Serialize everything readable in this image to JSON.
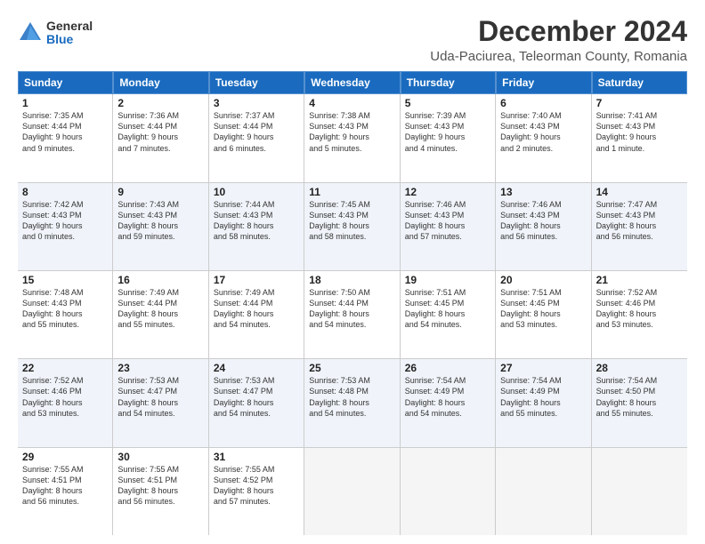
{
  "logo": {
    "general": "General",
    "blue": "Blue"
  },
  "title": "December 2024",
  "subtitle": "Uda-Paciurea, Teleorman County, Romania",
  "days": [
    "Sunday",
    "Monday",
    "Tuesday",
    "Wednesday",
    "Thursday",
    "Friday",
    "Saturday"
  ],
  "weeks": [
    [
      {
        "day": "1",
        "info": "Sunrise: 7:35 AM\nSunset: 4:44 PM\nDaylight: 9 hours\nand 9 minutes."
      },
      {
        "day": "2",
        "info": "Sunrise: 7:36 AM\nSunset: 4:44 PM\nDaylight: 9 hours\nand 7 minutes."
      },
      {
        "day": "3",
        "info": "Sunrise: 7:37 AM\nSunset: 4:44 PM\nDaylight: 9 hours\nand 6 minutes."
      },
      {
        "day": "4",
        "info": "Sunrise: 7:38 AM\nSunset: 4:43 PM\nDaylight: 9 hours\nand 5 minutes."
      },
      {
        "day": "5",
        "info": "Sunrise: 7:39 AM\nSunset: 4:43 PM\nDaylight: 9 hours\nand 4 minutes."
      },
      {
        "day": "6",
        "info": "Sunrise: 7:40 AM\nSunset: 4:43 PM\nDaylight: 9 hours\nand 2 minutes."
      },
      {
        "day": "7",
        "info": "Sunrise: 7:41 AM\nSunset: 4:43 PM\nDaylight: 9 hours\nand 1 minute."
      }
    ],
    [
      {
        "day": "8",
        "info": "Sunrise: 7:42 AM\nSunset: 4:43 PM\nDaylight: 9 hours\nand 0 minutes."
      },
      {
        "day": "9",
        "info": "Sunrise: 7:43 AM\nSunset: 4:43 PM\nDaylight: 8 hours\nand 59 minutes."
      },
      {
        "day": "10",
        "info": "Sunrise: 7:44 AM\nSunset: 4:43 PM\nDaylight: 8 hours\nand 58 minutes."
      },
      {
        "day": "11",
        "info": "Sunrise: 7:45 AM\nSunset: 4:43 PM\nDaylight: 8 hours\nand 58 minutes."
      },
      {
        "day": "12",
        "info": "Sunrise: 7:46 AM\nSunset: 4:43 PM\nDaylight: 8 hours\nand 57 minutes."
      },
      {
        "day": "13",
        "info": "Sunrise: 7:46 AM\nSunset: 4:43 PM\nDaylight: 8 hours\nand 56 minutes."
      },
      {
        "day": "14",
        "info": "Sunrise: 7:47 AM\nSunset: 4:43 PM\nDaylight: 8 hours\nand 56 minutes."
      }
    ],
    [
      {
        "day": "15",
        "info": "Sunrise: 7:48 AM\nSunset: 4:43 PM\nDaylight: 8 hours\nand 55 minutes."
      },
      {
        "day": "16",
        "info": "Sunrise: 7:49 AM\nSunset: 4:44 PM\nDaylight: 8 hours\nand 55 minutes."
      },
      {
        "day": "17",
        "info": "Sunrise: 7:49 AM\nSunset: 4:44 PM\nDaylight: 8 hours\nand 54 minutes."
      },
      {
        "day": "18",
        "info": "Sunrise: 7:50 AM\nSunset: 4:44 PM\nDaylight: 8 hours\nand 54 minutes."
      },
      {
        "day": "19",
        "info": "Sunrise: 7:51 AM\nSunset: 4:45 PM\nDaylight: 8 hours\nand 54 minutes."
      },
      {
        "day": "20",
        "info": "Sunrise: 7:51 AM\nSunset: 4:45 PM\nDaylight: 8 hours\nand 53 minutes."
      },
      {
        "day": "21",
        "info": "Sunrise: 7:52 AM\nSunset: 4:46 PM\nDaylight: 8 hours\nand 53 minutes."
      }
    ],
    [
      {
        "day": "22",
        "info": "Sunrise: 7:52 AM\nSunset: 4:46 PM\nDaylight: 8 hours\nand 53 minutes."
      },
      {
        "day": "23",
        "info": "Sunrise: 7:53 AM\nSunset: 4:47 PM\nDaylight: 8 hours\nand 54 minutes."
      },
      {
        "day": "24",
        "info": "Sunrise: 7:53 AM\nSunset: 4:47 PM\nDaylight: 8 hours\nand 54 minutes."
      },
      {
        "day": "25",
        "info": "Sunrise: 7:53 AM\nSunset: 4:48 PM\nDaylight: 8 hours\nand 54 minutes."
      },
      {
        "day": "26",
        "info": "Sunrise: 7:54 AM\nSunset: 4:49 PM\nDaylight: 8 hours\nand 54 minutes."
      },
      {
        "day": "27",
        "info": "Sunrise: 7:54 AM\nSunset: 4:49 PM\nDaylight: 8 hours\nand 55 minutes."
      },
      {
        "day": "28",
        "info": "Sunrise: 7:54 AM\nSunset: 4:50 PM\nDaylight: 8 hours\nand 55 minutes."
      }
    ],
    [
      {
        "day": "29",
        "info": "Sunrise: 7:55 AM\nSunset: 4:51 PM\nDaylight: 8 hours\nand 56 minutes."
      },
      {
        "day": "30",
        "info": "Sunrise: 7:55 AM\nSunset: 4:51 PM\nDaylight: 8 hours\nand 56 minutes."
      },
      {
        "day": "31",
        "info": "Sunrise: 7:55 AM\nSunset: 4:52 PM\nDaylight: 8 hours\nand 57 minutes."
      },
      {
        "day": "",
        "info": ""
      },
      {
        "day": "",
        "info": ""
      },
      {
        "day": "",
        "info": ""
      },
      {
        "day": "",
        "info": ""
      }
    ]
  ],
  "alt_rows": [
    1,
    3
  ]
}
